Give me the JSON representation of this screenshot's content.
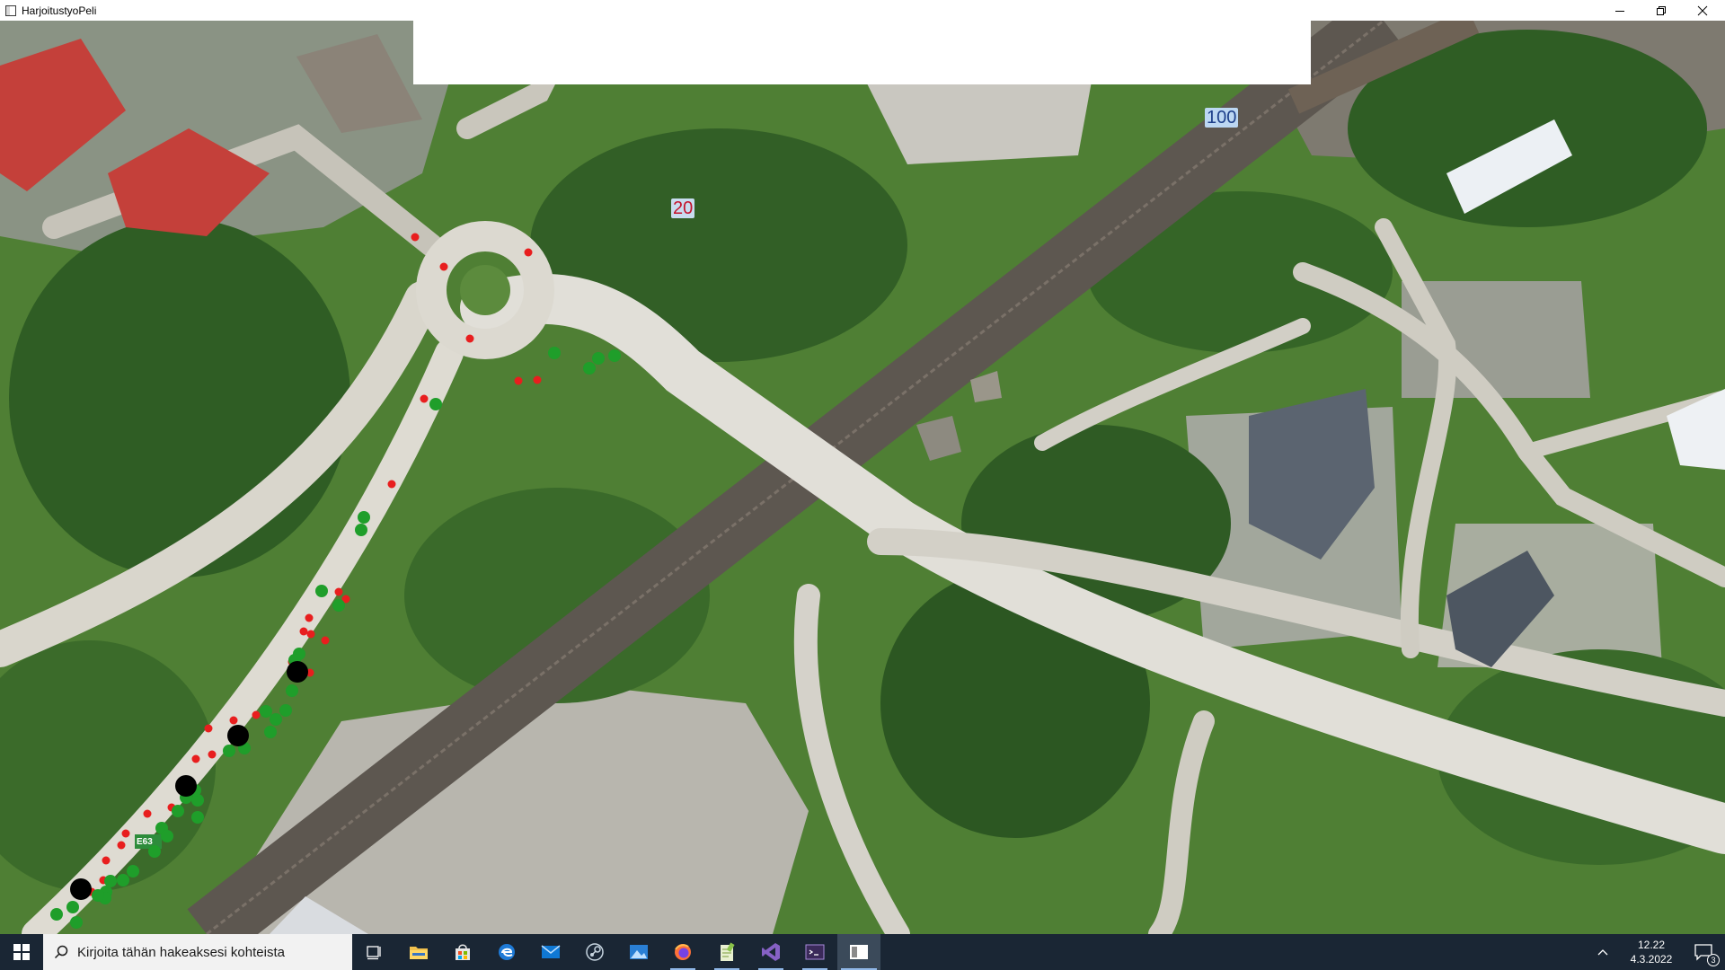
{
  "window": {
    "title": "HarjoitustyoPeli",
    "controls": [
      "minimize",
      "maximize",
      "close"
    ]
  },
  "game": {
    "speed_signs": [
      {
        "text": "100"
      },
      {
        "text": "20"
      }
    ],
    "route_marker": "E63",
    "legend": {
      "colors": {
        "red": "#e81e1e",
        "green": "#1f9e2a",
        "black": "#000000"
      }
    }
  },
  "taskbar": {
    "search_placeholder": "Kirjoita tähän hakeaksesi kohteista",
    "pinned": [
      "task-view",
      "file-explorer",
      "microsoft-store",
      "edge",
      "mail",
      "steam",
      "photos",
      "firefox",
      "notepad-plus-plus",
      "visual-studio",
      "terminal",
      "harjoitustyopeli"
    ],
    "clock": {
      "time": "12.22",
      "date": "4.3.2022"
    },
    "notifications_count": "3"
  }
}
